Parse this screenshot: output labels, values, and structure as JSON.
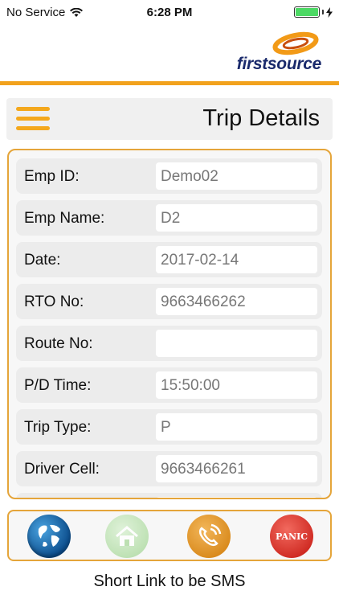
{
  "status_bar": {
    "carrier": "No Service",
    "time": "6:28 PM",
    "battery_level": 1.0,
    "icons": [
      "wifi-icon",
      "battery-icon",
      "charging-icon"
    ]
  },
  "brand": {
    "logo_text": "firstsource"
  },
  "header": {
    "title": "Trip Details",
    "menu_icon": "hamburger-menu-icon"
  },
  "details": [
    {
      "label": "Emp ID:",
      "value": "Demo02"
    },
    {
      "label": "Emp Name:",
      "value": "D2"
    },
    {
      "label": "Date:",
      "value": "2017-02-14"
    },
    {
      "label": "RTO No:",
      "value": "9663466262"
    },
    {
      "label": "Route No:",
      "value": ""
    },
    {
      "label": "P/D Time:",
      "value": "15:50:00"
    },
    {
      "label": "Trip Type:",
      "value": "P"
    },
    {
      "label": "Driver Cell:",
      "value": "9663466261"
    },
    {
      "label": "",
      "value": ""
    }
  ],
  "bottom_nav": {
    "buttons": [
      {
        "name": "globe-icon"
      },
      {
        "name": "home-icon"
      },
      {
        "name": "phone-call-icon"
      },
      {
        "name": "panic-button",
        "label": "PANIC"
      }
    ]
  },
  "footer": {
    "link_text": "Short Link to be SMS"
  },
  "colors": {
    "accent": "#f2a21c",
    "panel_border": "#e5a53a",
    "brand_blue": "#1a2a6c"
  }
}
